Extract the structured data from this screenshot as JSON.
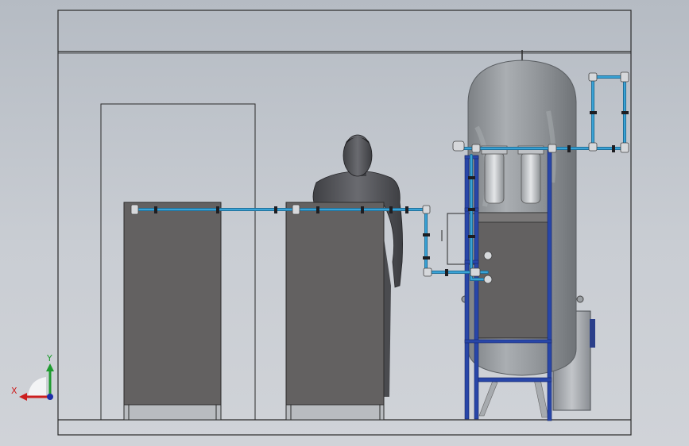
{
  "triad": {
    "x_label": "X",
    "y_label": "Y",
    "colors": {
      "x": "#cc1f1f",
      "y": "#1e9b2f",
      "z": "#1d2fa8"
    }
  },
  "colors": {
    "background": "#c5cad1",
    "room_line": "#2a2a2a",
    "cabinet": "#636161",
    "pipe": "#2a88b8",
    "frame": "#2846a8",
    "tank": "#8e9296"
  }
}
